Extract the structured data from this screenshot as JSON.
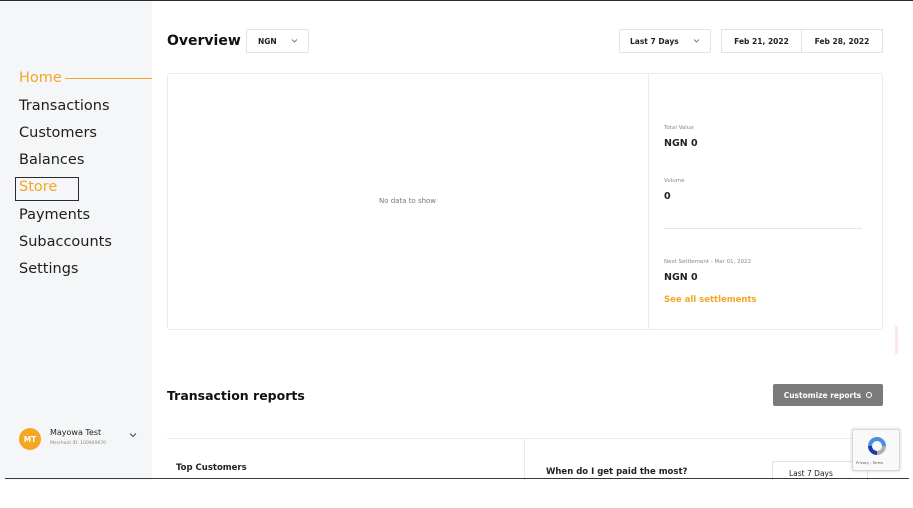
{
  "sidebar": {
    "items": [
      {
        "label": "Home",
        "active": true
      },
      {
        "label": "Transactions"
      },
      {
        "label": "Customers"
      },
      {
        "label": "Balances"
      },
      {
        "label": "Store",
        "focused": true
      },
      {
        "label": "Payments"
      },
      {
        "label": "Subaccounts"
      },
      {
        "label": "Settings"
      }
    ],
    "user": {
      "initials": "MT",
      "name": "Mayowa Test",
      "merchant_id": "Merchant ID: 100949970"
    }
  },
  "header": {
    "title": "Overview",
    "currency": "NGN",
    "range": "Last 7 Days",
    "start_date": "Feb 21, 2022",
    "end_date": "Feb 28, 2022"
  },
  "overview_card": {
    "empty_text": "No data to show",
    "total_value_label": "Total Value",
    "total_value": "NGN 0",
    "volume_label": "Volume",
    "volume": "0",
    "next_settlement_label": "Next Settlement - Mar 01, 2022",
    "next_settlement": "NGN 0",
    "see_all": "See all settlements"
  },
  "reports": {
    "title": "Transaction reports",
    "customize_label": "Customize reports",
    "top_customers": "Top Customers",
    "paid_most": "When do I get paid the most?",
    "range": "Last 7 Days"
  },
  "recaptcha": {
    "text": "Privacy - Terms"
  },
  "colors": {
    "accent": "#f5a623",
    "sidebar_bg": "#f5f6f7",
    "button_gray": "#7a7a7a"
  }
}
